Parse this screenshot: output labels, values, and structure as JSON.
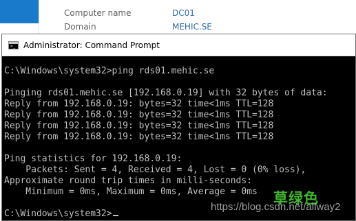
{
  "background_panel": {
    "rows": [
      {
        "label": "Computer name",
        "value": "DC01"
      },
      {
        "label": "Domain",
        "value": "MEHIC.SE"
      }
    ]
  },
  "cmd_window": {
    "title": "Administrator: Command Prompt",
    "icon": "command-prompt-icon",
    "lines": [
      "C:\\Windows\\system32>ping rds01.mehic.se",
      "",
      "Pinging rds01.mehic.se [192.168.0.19] with 32 bytes of data:",
      "Reply from 192.168.0.19: bytes=32 time<1ms TTL=128",
      "Reply from 192.168.0.19: bytes=32 time<1ms TTL=128",
      "Reply from 192.168.0.19: bytes=32 time<1ms TTL=128",
      "Reply from 192.168.0.19: bytes=32 time<1ms TTL=128",
      "",
      "Ping statistics for 192.168.0.19:",
      "    Packets: Sent = 4, Received = 4, Lost = 0 (0% loss),",
      "Approximate round trip times in milli-seconds:",
      "    Minimum = 0ms, Maximum = 0ms, Average = 0ms",
      "",
      "C:\\Windows\\system32>"
    ]
  },
  "watermark": {
    "chinese": "草绿色",
    "url": "https://blog.csdn.net/allway2"
  },
  "colors": {
    "console_bg": "#000000",
    "console_text": "#c0c0c0",
    "link_blue": "#2d6ab1",
    "accent_blue": "#1979ca",
    "watermark_green": "#3fb42d"
  }
}
